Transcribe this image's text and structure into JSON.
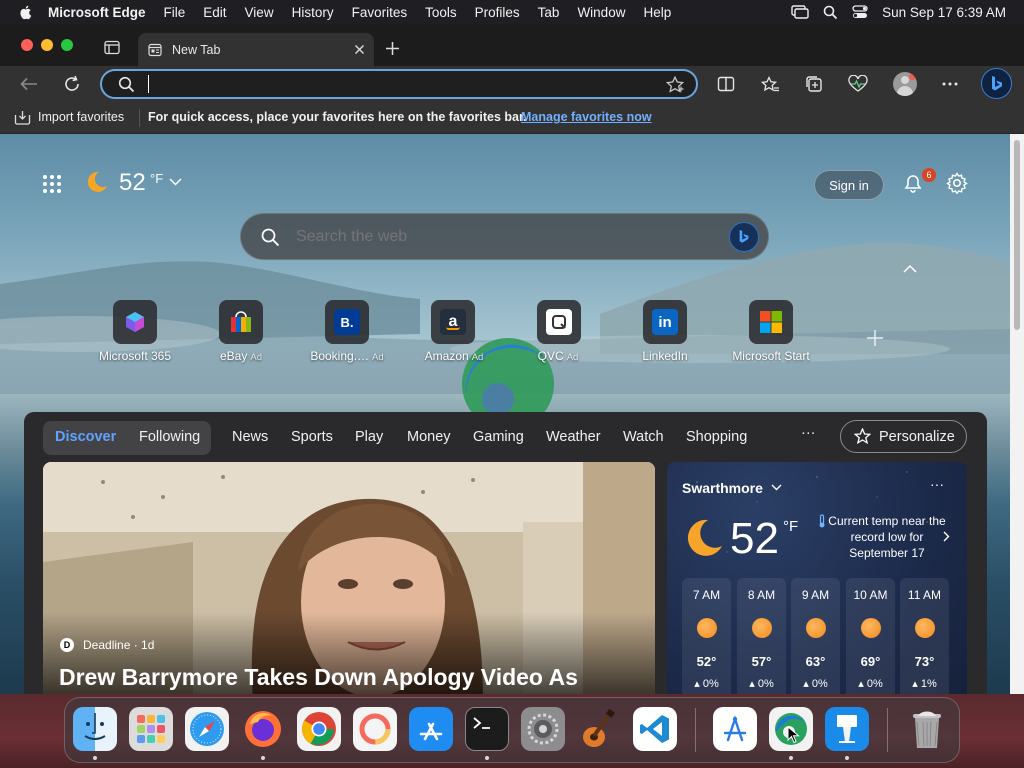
{
  "menubar": {
    "app_name": "Microsoft Edge",
    "items": [
      "File",
      "Edit",
      "View",
      "History",
      "Favorites",
      "Tools",
      "Profiles",
      "Tab",
      "Window",
      "Help"
    ],
    "clock": "Sun Sep 17  6:39 AM"
  },
  "tab": {
    "title": "New Tab"
  },
  "address": {
    "value": ""
  },
  "favorites_bar": {
    "import_label": "Import favorites",
    "hint": "For quick access, place your favorites here on the favorites bar.",
    "manage_link": "Manage favorites now"
  },
  "ntp": {
    "temp": "52",
    "unit": "°F",
    "sign_in": "Sign in",
    "notif_count": "6",
    "search_placeholder": "Search the web",
    "quick_links": [
      {
        "label": "Microsoft 365",
        "ad": ""
      },
      {
        "label": "eBay",
        "ad": "Ad"
      },
      {
        "label": "Booking.…",
        "ad": "Ad"
      },
      {
        "label": "Amazon",
        "ad": "Ad"
      },
      {
        "label": "QVC",
        "ad": "Ad"
      },
      {
        "label": "LinkedIn",
        "ad": ""
      },
      {
        "label": "Microsoft Start",
        "ad": ""
      }
    ]
  },
  "feed": {
    "tabs": [
      "Discover",
      "Following"
    ],
    "nav": [
      "News",
      "Sports",
      "Play",
      "Money",
      "Gaming",
      "Weather",
      "Watch",
      "Shopping"
    ],
    "more": "···",
    "personalize": "Personalize",
    "hero": {
      "source": "Deadline · 1d",
      "headline": "Drew Barrymore Takes Down Apology Video As"
    },
    "weather": {
      "location": "Swarthmore",
      "temp": "52",
      "unit": "°F",
      "note": "Current temp near the record low for September 17",
      "more": "···",
      "hours": [
        {
          "time": "7 AM",
          "temp": "52°",
          "precip": "0%"
        },
        {
          "time": "8 AM",
          "temp": "57°",
          "precip": "0%"
        },
        {
          "time": "9 AM",
          "temp": "63°",
          "precip": "0%"
        },
        {
          "time": "10 AM",
          "temp": "69°",
          "precip": "0%"
        },
        {
          "time": "11 AM",
          "temp": "73°",
          "precip": "1%"
        }
      ]
    }
  },
  "dock": {
    "apps": [
      "Finder",
      "Launchpad",
      "Safari",
      "Firefox",
      "Google Chrome",
      "Pixelmator",
      "App Store",
      "Terminal",
      "System Settings",
      "GarageBand",
      "Visual Studio Code",
      "Xcode Instruments",
      "Microsoft Edge",
      "Keynote",
      "Trash"
    ]
  },
  "colors": {
    "accent": "#6aa6e0",
    "link": "#72b0ff",
    "discover": "#5ea3ff",
    "badge": "#d64524"
  }
}
